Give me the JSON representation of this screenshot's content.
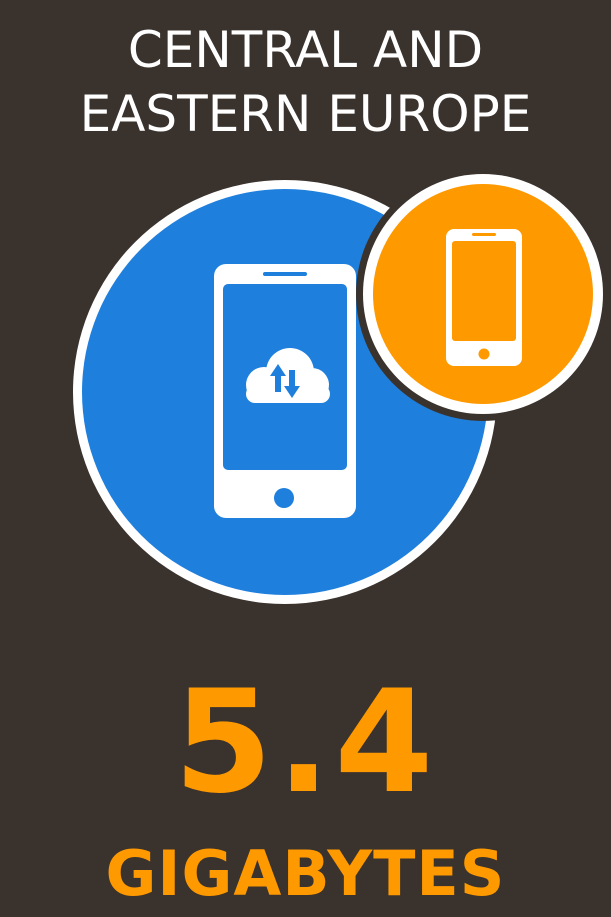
{
  "heading": {
    "line1": "CENTRAL AND",
    "line2": "EASTERN EUROPE"
  },
  "stat": {
    "value": "5.4",
    "unit": "GIGABYTES"
  },
  "icons": {
    "large": "smartphone-cloud-sync-icon",
    "small": "smartphone-icon"
  },
  "colors": {
    "background": "#3a322d",
    "blue": "#1f7fdc",
    "orange": "#ff9900",
    "white": "#ffffff"
  }
}
